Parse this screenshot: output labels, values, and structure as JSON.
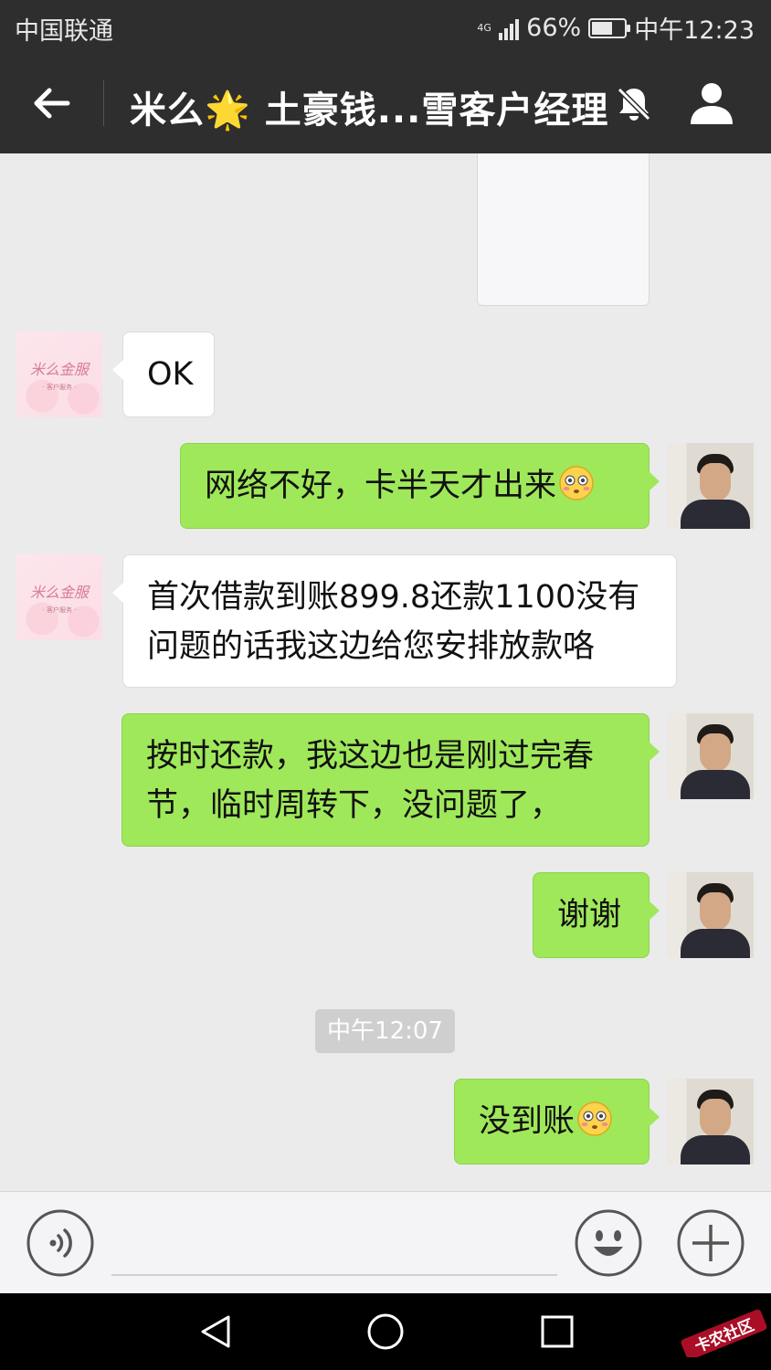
{
  "status_bar": {
    "carrier": "中国联通",
    "network": "4G",
    "battery_level": 0.66,
    "battery": "66%",
    "time": "中午12:23"
  },
  "header": {
    "title": "米么🌟 土豪钱...雪客户经理",
    "icons": [
      "back-arrow-icon",
      "mute-bell-icon",
      "profile-icon"
    ]
  },
  "messages": [
    {
      "side": "left",
      "text": "OK"
    },
    {
      "side": "right",
      "text": "网络不好，卡半天才出来",
      "emoji": "flushed-face"
    },
    {
      "side": "left",
      "line1": "首次借款到账899.8还款1100没有",
      "line2": "问题的话我这边给您安排放款咯"
    },
    {
      "side": "right",
      "line1": "按时还款，我这边也是刚过完春",
      "line2": "节，临时周转下，没问题了，"
    },
    {
      "side": "right",
      "text": "谢谢"
    },
    {
      "side": "right",
      "text": "没到账",
      "emoji": "flushed-face"
    }
  ],
  "time_divider": "中午12:07",
  "contact_avatar": {
    "brand_text": "米么金服",
    "sub_text": "· 客户服务 ·"
  },
  "input_bar": {
    "text": "",
    "icons": [
      "voice-icon",
      "emoji-icon",
      "plus-icon"
    ]
  },
  "nav_bar": {
    "icons": [
      "nav-back-icon",
      "nav-home-icon",
      "nav-recent-icon"
    ]
  },
  "watermark": {
    "text": "卡农社区"
  },
  "colors": {
    "bar": "#2e2e2e",
    "chat_bg": "#ebebeb",
    "sent_bubble": "#9fe85a",
    "received_bubble": "#ffffff"
  }
}
